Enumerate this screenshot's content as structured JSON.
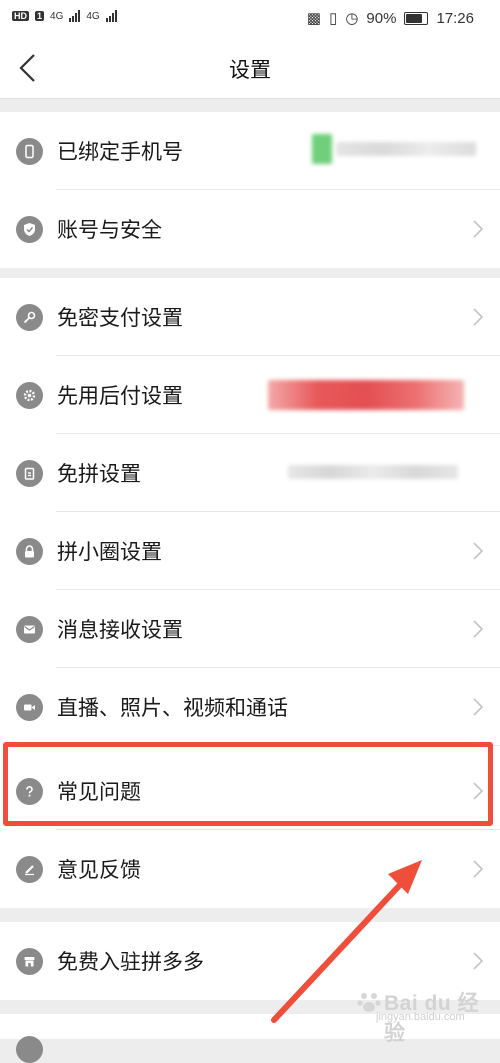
{
  "status_bar": {
    "left_badges": [
      "HD",
      "1",
      "4G",
      "4G"
    ],
    "battery": "90%",
    "time": "17:26"
  },
  "nav": {
    "title": "设置"
  },
  "groups": [
    {
      "rows": [
        {
          "label": "已绑定手机号",
          "icon": "phone-icon",
          "chevron": false,
          "masked": true
        },
        {
          "label": "账号与安全",
          "icon": "shield-check-icon",
          "chevron": true
        }
      ]
    },
    {
      "rows": [
        {
          "label": "免密支付设置",
          "icon": "key-icon",
          "chevron": true
        },
        {
          "label": "先用后付设置",
          "icon": "gear-icon",
          "chevron": false,
          "masked": true
        },
        {
          "label": "免拼设置",
          "icon": "clipboard-icon",
          "chevron": false,
          "masked": true
        },
        {
          "label": "拼小圈设置",
          "icon": "lock-icon",
          "chevron": true
        },
        {
          "label": "消息接收设置",
          "icon": "mail-icon",
          "chevron": true
        },
        {
          "label": "直播、照片、视频和通话",
          "icon": "video-camera-icon",
          "chevron": true
        },
        {
          "label": "常见问题",
          "icon": "question-icon",
          "chevron": true
        },
        {
          "label": "意见反馈",
          "icon": "pencil-icon",
          "chevron": true
        }
      ]
    },
    {
      "rows": [
        {
          "label": "免费入驻拼多多",
          "icon": "store-icon",
          "chevron": true
        }
      ]
    }
  ],
  "colors": {
    "accent_red": "#ef4f3a",
    "icon_gray": "#8a8a8a"
  },
  "watermark": {
    "brand": "Bai du 经验",
    "url": "jingyan.baidu.com"
  }
}
